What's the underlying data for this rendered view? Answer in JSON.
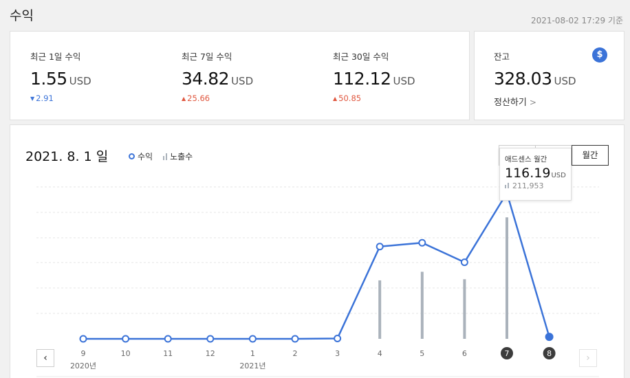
{
  "page": {
    "title": "수익",
    "basis": "2021-08-02 17:29 기준"
  },
  "summary": [
    {
      "label": "최근 1일 수익",
      "value": "1.55",
      "unit": "USD",
      "delta": "2.91",
      "direction": "down"
    },
    {
      "label": "최근 7일 수익",
      "value": "34.82",
      "unit": "USD",
      "delta": "25.66",
      "direction": "up"
    },
    {
      "label": "최근 30일 수익",
      "value": "112.12",
      "unit": "USD",
      "delta": "50.85",
      "direction": "up"
    }
  ],
  "balance": {
    "label": "잔고",
    "value": "328.03",
    "unit": "USD",
    "settle_label": "정산하기",
    "icon": "dollar-icon"
  },
  "chart": {
    "date_label": "2021. 8. 1 일",
    "legend": {
      "revenue": "수익",
      "impressions": "노출수"
    },
    "tabs": [
      "",
      "",
      "월간"
    ],
    "active_tab": 2,
    "tooltip": {
      "title": "애드센스 월간",
      "value": "116.19",
      "unit": "USD",
      "impressions": "211,953"
    },
    "nav": {
      "prev": "‹",
      "next": "›"
    }
  },
  "colors": {
    "accent": "#3b73d8",
    "bar": "#aab2bb",
    "up": "#e0573f",
    "down": "#3b73d8"
  },
  "chart_data": {
    "type": "line",
    "x": [
      "9",
      "10",
      "11",
      "12",
      "1",
      "2",
      "3",
      "4",
      "5",
      "6",
      "7",
      "8"
    ],
    "year_labels": [
      {
        "index": 0,
        "text": "2020년"
      },
      {
        "index": 4,
        "text": "2021년"
      }
    ],
    "highlighted": [
      10,
      11
    ],
    "series": [
      {
        "name": "수익",
        "kind": "line",
        "values": [
          0,
          0,
          0,
          0,
          0,
          0,
          0.3,
          73.5,
          76.5,
          61.0,
          116.19,
          1.55
        ]
      },
      {
        "name": "노출수",
        "kind": "bar",
        "values": [
          0,
          0,
          0,
          0,
          0,
          0,
          0,
          102000,
          117000,
          104000,
          211953,
          0
        ]
      }
    ],
    "ylim": [
      0,
      121
    ],
    "imp_lim": [
      0,
      265000
    ],
    "grid": true
  }
}
